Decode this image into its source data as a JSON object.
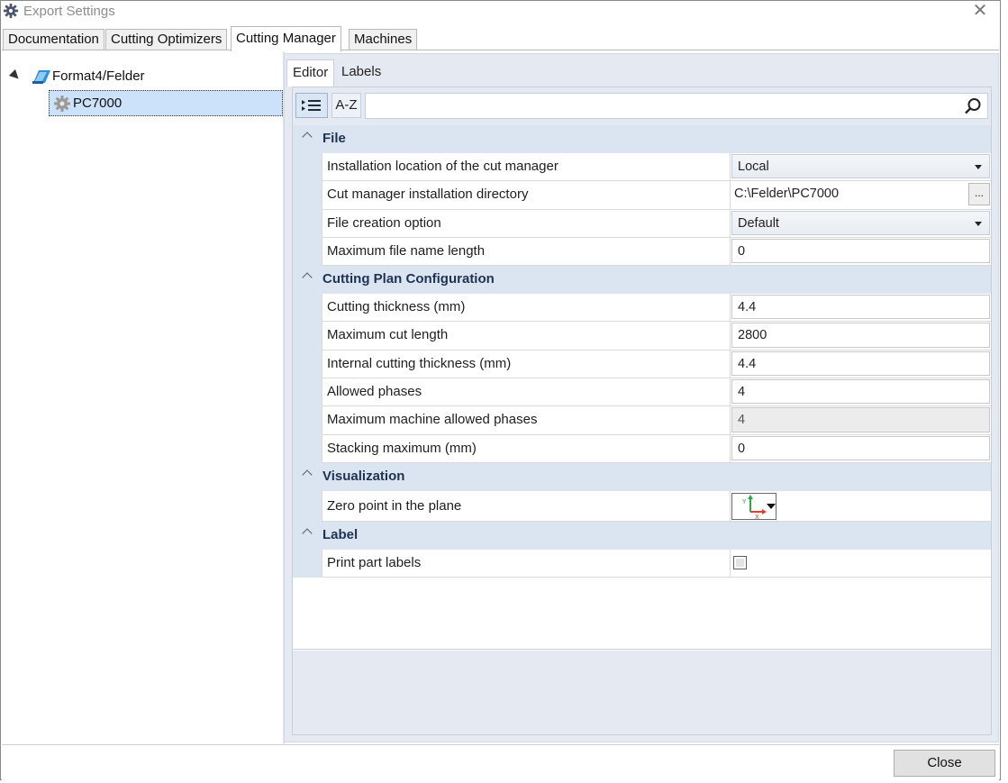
{
  "window": {
    "title": "Export Settings",
    "close_glyph": "✕"
  },
  "main_tabs": [
    {
      "label": "Documentation"
    },
    {
      "label": "Cutting Optimizers"
    },
    {
      "label": "Cutting Manager",
      "active": true
    },
    {
      "label": "Machines"
    }
  ],
  "tree": {
    "root": {
      "label": "Format4/Felder",
      "icon": "folder-brand-icon"
    },
    "child": {
      "label": "PC7000",
      "icon": "gear-icon",
      "selected": true
    }
  },
  "sub_tabs": [
    {
      "label": "Editor",
      "active": true
    },
    {
      "label": "Labels"
    }
  ],
  "toolbar": {
    "categorized_icon": "categorized-list-icon",
    "alpha_label": "A-Z",
    "search_value": "",
    "search_icon": "search-icon"
  },
  "categories": [
    {
      "label": "File",
      "rows": [
        {
          "name": "Installation location of the cut manager",
          "value": "Local",
          "kind": "combo"
        },
        {
          "name": "Cut manager installation directory",
          "value": "C:\\Felder\\PC7000",
          "kind": "browse",
          "button": "..."
        },
        {
          "name": "File creation option",
          "value": "Default",
          "kind": "combo"
        },
        {
          "name": "Maximum file name length",
          "value": "0",
          "kind": "text"
        }
      ]
    },
    {
      "label": "Cutting Plan Configuration",
      "rows": [
        {
          "name": "Cutting thickness (mm)",
          "value": "4.4",
          "kind": "text"
        },
        {
          "name": "Maximum cut length",
          "value": "2800",
          "kind": "text"
        },
        {
          "name": "Internal cutting thickness (mm)",
          "value": "4.4",
          "kind": "text"
        },
        {
          "name": "Allowed phases",
          "value": "4",
          "kind": "text"
        },
        {
          "name": "Maximum machine allowed phases",
          "value": "4",
          "kind": "disabled"
        },
        {
          "name": "Stacking maximum (mm)",
          "value": "0",
          "kind": "text"
        }
      ]
    },
    {
      "label": "Visualization",
      "rows": [
        {
          "name": "Zero point in the plane",
          "value": "",
          "kind": "zero-point"
        }
      ]
    },
    {
      "label": "Label",
      "rows": [
        {
          "name": "Print part labels",
          "value": "",
          "kind": "checkbox",
          "checked": false
        }
      ]
    }
  ],
  "axis_glyphs": {
    "y": "Y",
    "x": "X"
  },
  "footer": {
    "close_label": "Close"
  },
  "colors": {
    "accent": "#cce2fb",
    "panel": "#e5eaf2",
    "category": "#dbe5f2",
    "category_text": "#1f3250"
  }
}
